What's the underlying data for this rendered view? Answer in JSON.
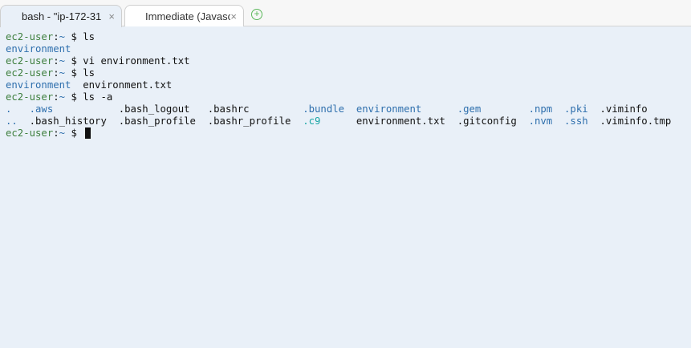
{
  "tabs": [
    {
      "label": "bash - \"ip-172-31",
      "close": "×"
    },
    {
      "label": "Immediate (Javascript",
      "close": "×"
    }
  ],
  "add_tab_label": "+",
  "terminal": {
    "user": "ec2-user",
    "sep": ":",
    "path": "~",
    "dollar": " $ ",
    "cmd1": "ls",
    "out1": "environment",
    "cmd2": "vi environment.txt",
    "cmd3": "ls",
    "out3_dir": "environment",
    "out3_file": "  environment.txt",
    "cmd4": "ls -a",
    "row1": [
      {
        "t": ".",
        "k": "b"
      },
      {
        "t": "   ",
        "k": ""
      },
      {
        "t": ".aws",
        "k": "b"
      },
      {
        "t": "           ",
        "k": ""
      },
      {
        "t": ".bash_logout",
        "k": ""
      },
      {
        "t": "   ",
        "k": ""
      },
      {
        "t": ".bashrc",
        "k": ""
      },
      {
        "t": "         ",
        "k": ""
      },
      {
        "t": ".bundle",
        "k": "b"
      },
      {
        "t": "  ",
        "k": ""
      },
      {
        "t": "environment",
        "k": "b"
      },
      {
        "t": "      ",
        "k": ""
      },
      {
        "t": ".gem",
        "k": "b"
      },
      {
        "t": "        ",
        "k": ""
      },
      {
        "t": ".npm",
        "k": "b"
      },
      {
        "t": "  ",
        "k": ""
      },
      {
        "t": ".pki",
        "k": "b"
      },
      {
        "t": "  ",
        "k": ""
      },
      {
        "t": ".viminfo",
        "k": ""
      }
    ],
    "row2": [
      {
        "t": "..",
        "k": "b"
      },
      {
        "t": "  ",
        "k": ""
      },
      {
        "t": ".bash_history",
        "k": ""
      },
      {
        "t": "  ",
        "k": ""
      },
      {
        "t": ".bash_profile",
        "k": ""
      },
      {
        "t": "  ",
        "k": ""
      },
      {
        "t": ".bashr_profile",
        "k": ""
      },
      {
        "t": "  ",
        "k": ""
      },
      {
        "t": ".c9",
        "k": "c"
      },
      {
        "t": "      ",
        "k": ""
      },
      {
        "t": "environment.txt",
        "k": ""
      },
      {
        "t": "  ",
        "k": ""
      },
      {
        "t": ".gitconfig",
        "k": ""
      },
      {
        "t": "  ",
        "k": ""
      },
      {
        "t": ".nvm",
        "k": "b"
      },
      {
        "t": "  ",
        "k": ""
      },
      {
        "t": ".ssh",
        "k": "b"
      },
      {
        "t": "  ",
        "k": ""
      },
      {
        "t": ".viminfo.tmp",
        "k": ""
      }
    ]
  },
  "colors": {
    "prompt_user": "#3e7f3e",
    "directory": "#2e6fad",
    "special_dir": "#1aa6a6",
    "terminal_bg": "#e9f0f8"
  }
}
